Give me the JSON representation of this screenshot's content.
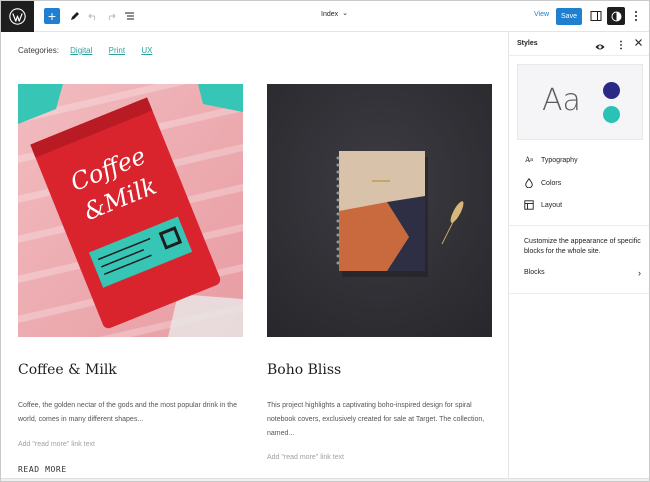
{
  "toolbar": {
    "document_title": "Index",
    "view_label": "View",
    "save_label": "Save"
  },
  "canvas": {
    "categories_label": "Categories:",
    "categories": [
      "Digital",
      "Print",
      "UX"
    ],
    "posts": [
      {
        "title": "Coffee & Milk",
        "excerpt": "Coffee, the golden nectar of the gods and the most popular drink in the world, comes in many different shapes...",
        "read_more_hint": "Add \"read more\" link text",
        "image_desc": "coffee-milk-pouch"
      },
      {
        "title": "Boho Bliss",
        "excerpt": "This project highlights a captivating boho-inspired design for spiral notebook covers, exclusively created for sale at Target. The collection, named...",
        "read_more_hint": "Add \"read more\" link text",
        "image_desc": "spiral-notebook"
      }
    ],
    "read_more_label": "READ MORE"
  },
  "sidebar": {
    "title": "Styles",
    "preview_text": "Aa",
    "preview_colors": [
      "#2a2a85",
      "#2cc1b5"
    ],
    "nav": [
      {
        "label": "Typography",
        "icon": "typography-icon"
      },
      {
        "label": "Colors",
        "icon": "droplet-icon"
      },
      {
        "label": "Layout",
        "icon": "layout-icon"
      }
    ],
    "description": "Customize the appearance of specific blocks for the whole site.",
    "blocks_label": "Blocks"
  },
  "colors": {
    "accent": "#1f7fd0",
    "link": "#2aa39a"
  }
}
